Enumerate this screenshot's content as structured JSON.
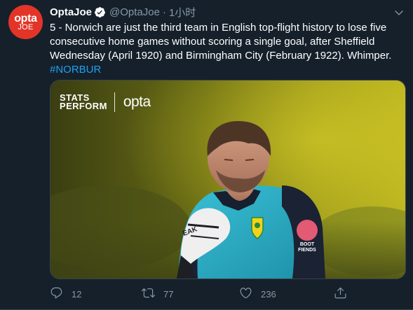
{
  "author": {
    "name": "OptaJoe",
    "handle": "@OptaJoe",
    "separator": "·",
    "time": "1小时",
    "avatar_line1": "opta",
    "avatar_line2": "JOE"
  },
  "tweet": {
    "text": "5 - Norwich are just the third team in English top-flight history to lose five consecutive home games without scoring a single goal, after Sheffield Wednesday (April 1920) and Birmingham City (February 1922). Whimper. ",
    "hashtag": "#NORBUR"
  },
  "media": {
    "brand_line1": "STATS",
    "brand_line2": "PERFORM",
    "brand_opta": "opta",
    "badge_text_1": "BOOT",
    "badge_text_2": "FIENDS",
    "glove_text": "EAK"
  },
  "actions": {
    "reply_icon": "reply-icon",
    "reply_count": "12",
    "retweet_icon": "retweet-icon",
    "retweet_count": "77",
    "like_icon": "heart-icon",
    "like_count": "236",
    "share_icon": "share-icon"
  },
  "colors": {
    "background": "#15202b",
    "secondary_text": "#8899a6",
    "accent": "#1da1f2",
    "avatar": "#e23528"
  }
}
